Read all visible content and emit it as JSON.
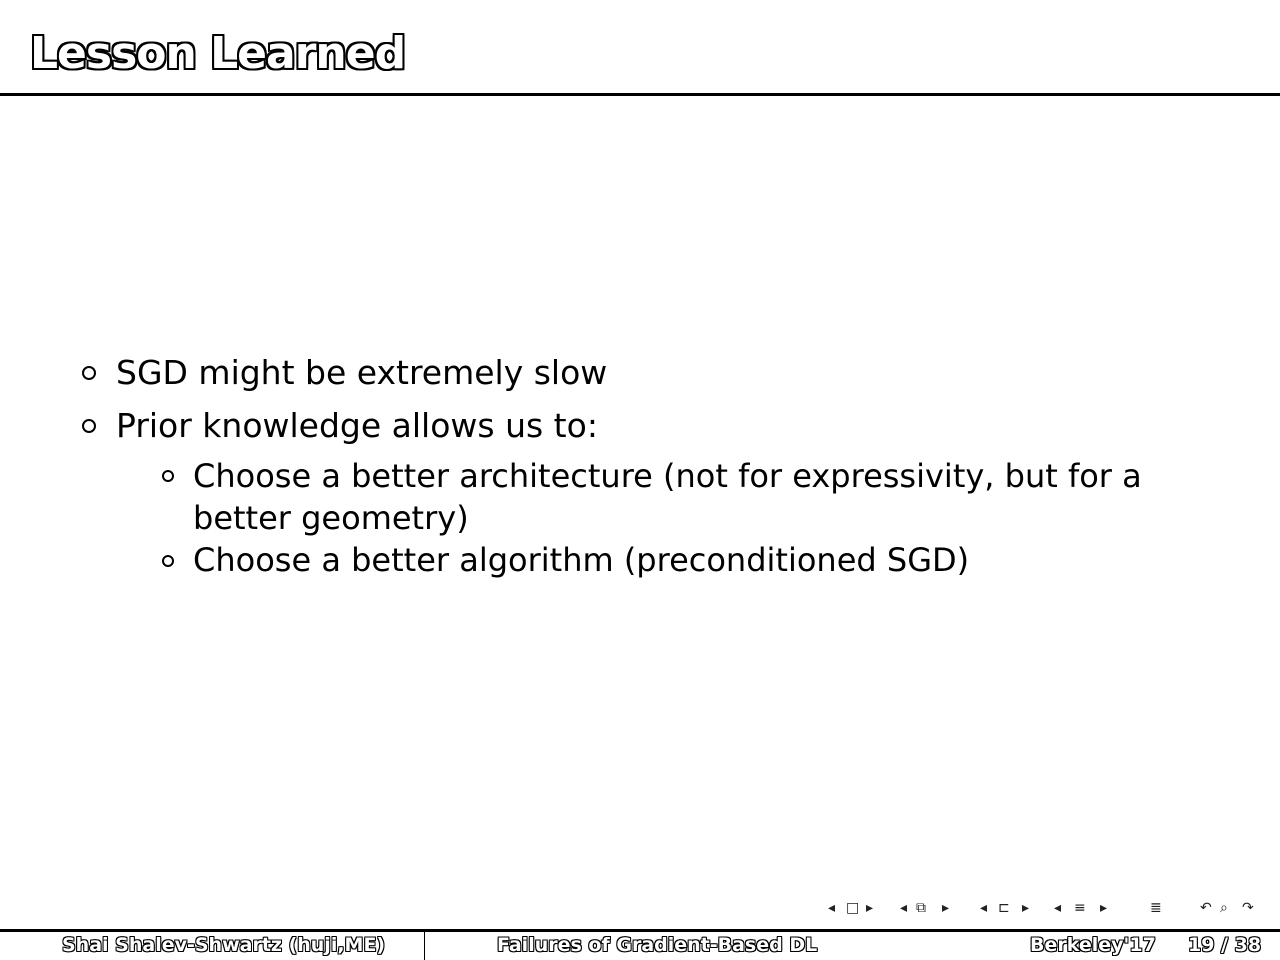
{
  "slide": {
    "title": "Lesson Learned"
  },
  "bullets": [
    {
      "text": "SGD might be extremely slow"
    },
    {
      "text": "Prior knowledge allows us to:"
    }
  ],
  "sub_bullets": [
    {
      "text": "Choose a better architecture (not for expressivity, but for a better geometry)"
    },
    {
      "text": "Choose a better algorithm (preconditioned SGD)"
    }
  ],
  "footer": {
    "author": "Shai Shalev-Shwartz  (huji,ME)",
    "talk_title": "Failures of Gradient-Based DL",
    "venue": "Berkeley'17",
    "page": "19 / 38"
  },
  "nav": {
    "icons": [
      "nav-frame-icon",
      "nav-subsection-icon",
      "nav-section-icon",
      "nav-outline-icon",
      "nav-search-icon",
      "nav-undo-icon"
    ]
  }
}
